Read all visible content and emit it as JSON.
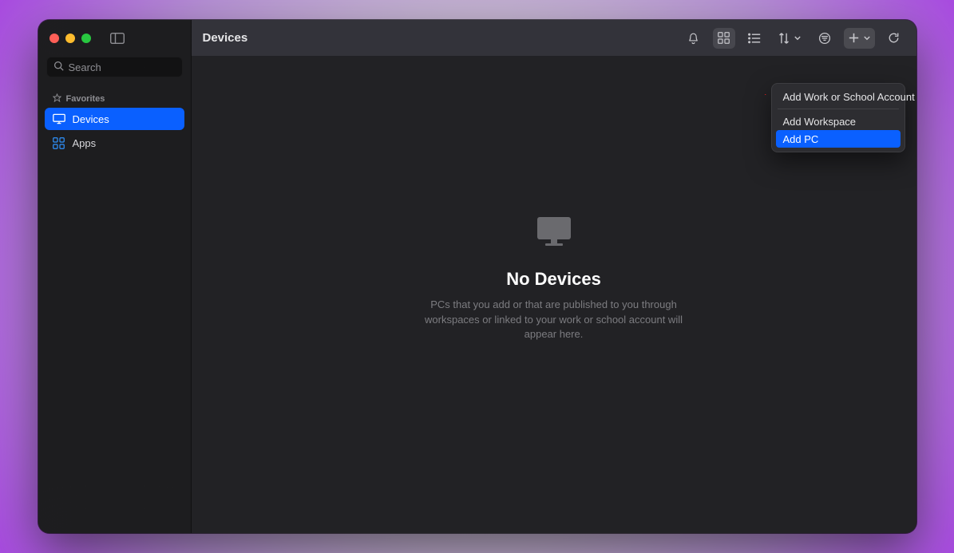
{
  "header": {
    "title": "Devices"
  },
  "search": {
    "placeholder": "Search"
  },
  "sidebar": {
    "section": "Favorites",
    "items": [
      {
        "label": "Devices",
        "icon": "monitor-icon",
        "selected": true
      },
      {
        "label": "Apps",
        "icon": "apps-icon",
        "selected": false
      }
    ]
  },
  "empty": {
    "title": "No Devices",
    "subtitle": "PCs that you add or that are published to you through workspaces or linked to your work or school account will appear here."
  },
  "menu": {
    "items": [
      {
        "label": "Add Work or School Account",
        "highlight": false
      },
      {
        "label": "Add Workspace",
        "highlight": false
      },
      {
        "label": "Add PC",
        "highlight": true
      }
    ]
  }
}
